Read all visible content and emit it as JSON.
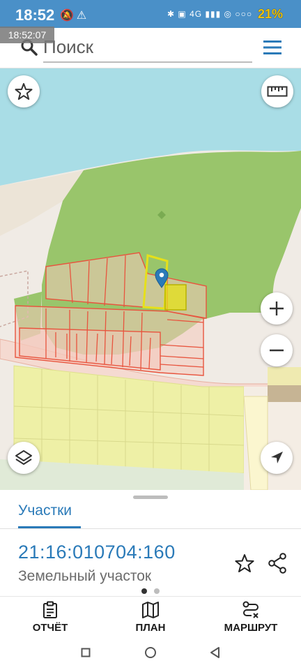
{
  "status_bar": {
    "time": "18:52",
    "battery": "21%",
    "network": "4G",
    "overlay_time": "18:52:07"
  },
  "search": {
    "placeholder": "Поиск"
  },
  "sheet": {
    "tab": "Участки",
    "cadastral_number": "21:16:010704:160",
    "parcel_type": "Земельный участок",
    "page_count": 2,
    "active_page": 1
  },
  "actions": {
    "report": "ОТЧЁТ",
    "plan": "ПЛАН",
    "route": "МАРШРУТ"
  },
  "colors": {
    "accent": "#2a7ab8",
    "statusbar": "#4a90c8",
    "water": "#a9dde6",
    "forest": "#99c56b",
    "parcel_outline": "#e8543e",
    "parcel_fill": "#f4d2c8",
    "selected_outline": "#e6e01a",
    "planned_zone": "#eef0a6"
  },
  "icons": {
    "search": "search-icon",
    "menu": "menu-icon",
    "favorite": "star-icon",
    "ruler": "ruler-icon",
    "zoom_in": "plus-icon",
    "zoom_out": "minus-icon",
    "layers": "layers-icon",
    "locate": "navigation-arrow-icon",
    "marker": "location-pin-icon",
    "report": "clipboard-icon",
    "plan": "map-icon",
    "route": "route-icon",
    "share": "share-icon"
  }
}
